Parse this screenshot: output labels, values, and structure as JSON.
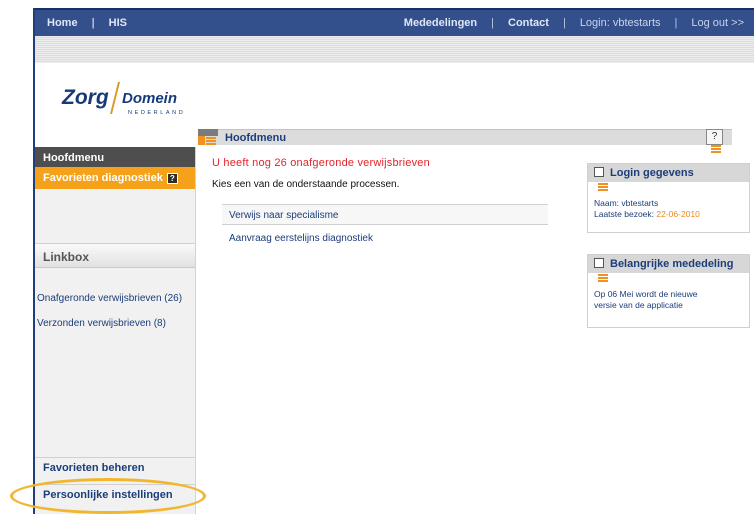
{
  "topbar": {
    "home": "Home",
    "his": "HIS",
    "mededelingen": "Mededelingen",
    "contact": "Contact",
    "login": "Login: vbtestarts",
    "logout": "Log out >>"
  },
  "logo": {
    "zorg": "Zorg",
    "domein": "Domein",
    "region": "NEDERLAND"
  },
  "sidebar": {
    "header": "Hoofdmenu",
    "favorites": "Favorieten diagnostiek",
    "favorites_help": "?",
    "linkbox": "Linkbox",
    "links": [
      {
        "label": "Onafgeronde verwijsbrieven (26)"
      },
      {
        "label": "Verzonden verwijsbrieven (8)"
      }
    ],
    "bottom": [
      {
        "label": "Favorieten beheren"
      },
      {
        "label": "Persoonlijke instellingen"
      }
    ]
  },
  "main": {
    "title": "Hoofdmenu",
    "help": "?",
    "alert": "U heeft nog 26 onafgeronde verwijsbrieven",
    "intro": "Kies een van de onderstaande processen.",
    "processes": [
      {
        "label": "Verwijs naar specialisme"
      },
      {
        "label": "Aanvraag eerstelijns diagnostiek"
      }
    ]
  },
  "login_panel": {
    "title": "Login gegevens",
    "name": "Naam: vbtestarts",
    "last_visit_label": "Laatste bezoek:",
    "last_visit_date": "22-06-2010"
  },
  "notice_panel": {
    "title": "Belangrijke mededeling",
    "text_line1": "Op 06 Mei wordt de nieuwe",
    "text_line2": "versie van de applicatie"
  },
  "colors": {
    "nav": "#33508c",
    "accent": "#f5a21a",
    "alert": "#e3242b",
    "link": "#1b3d7a"
  }
}
